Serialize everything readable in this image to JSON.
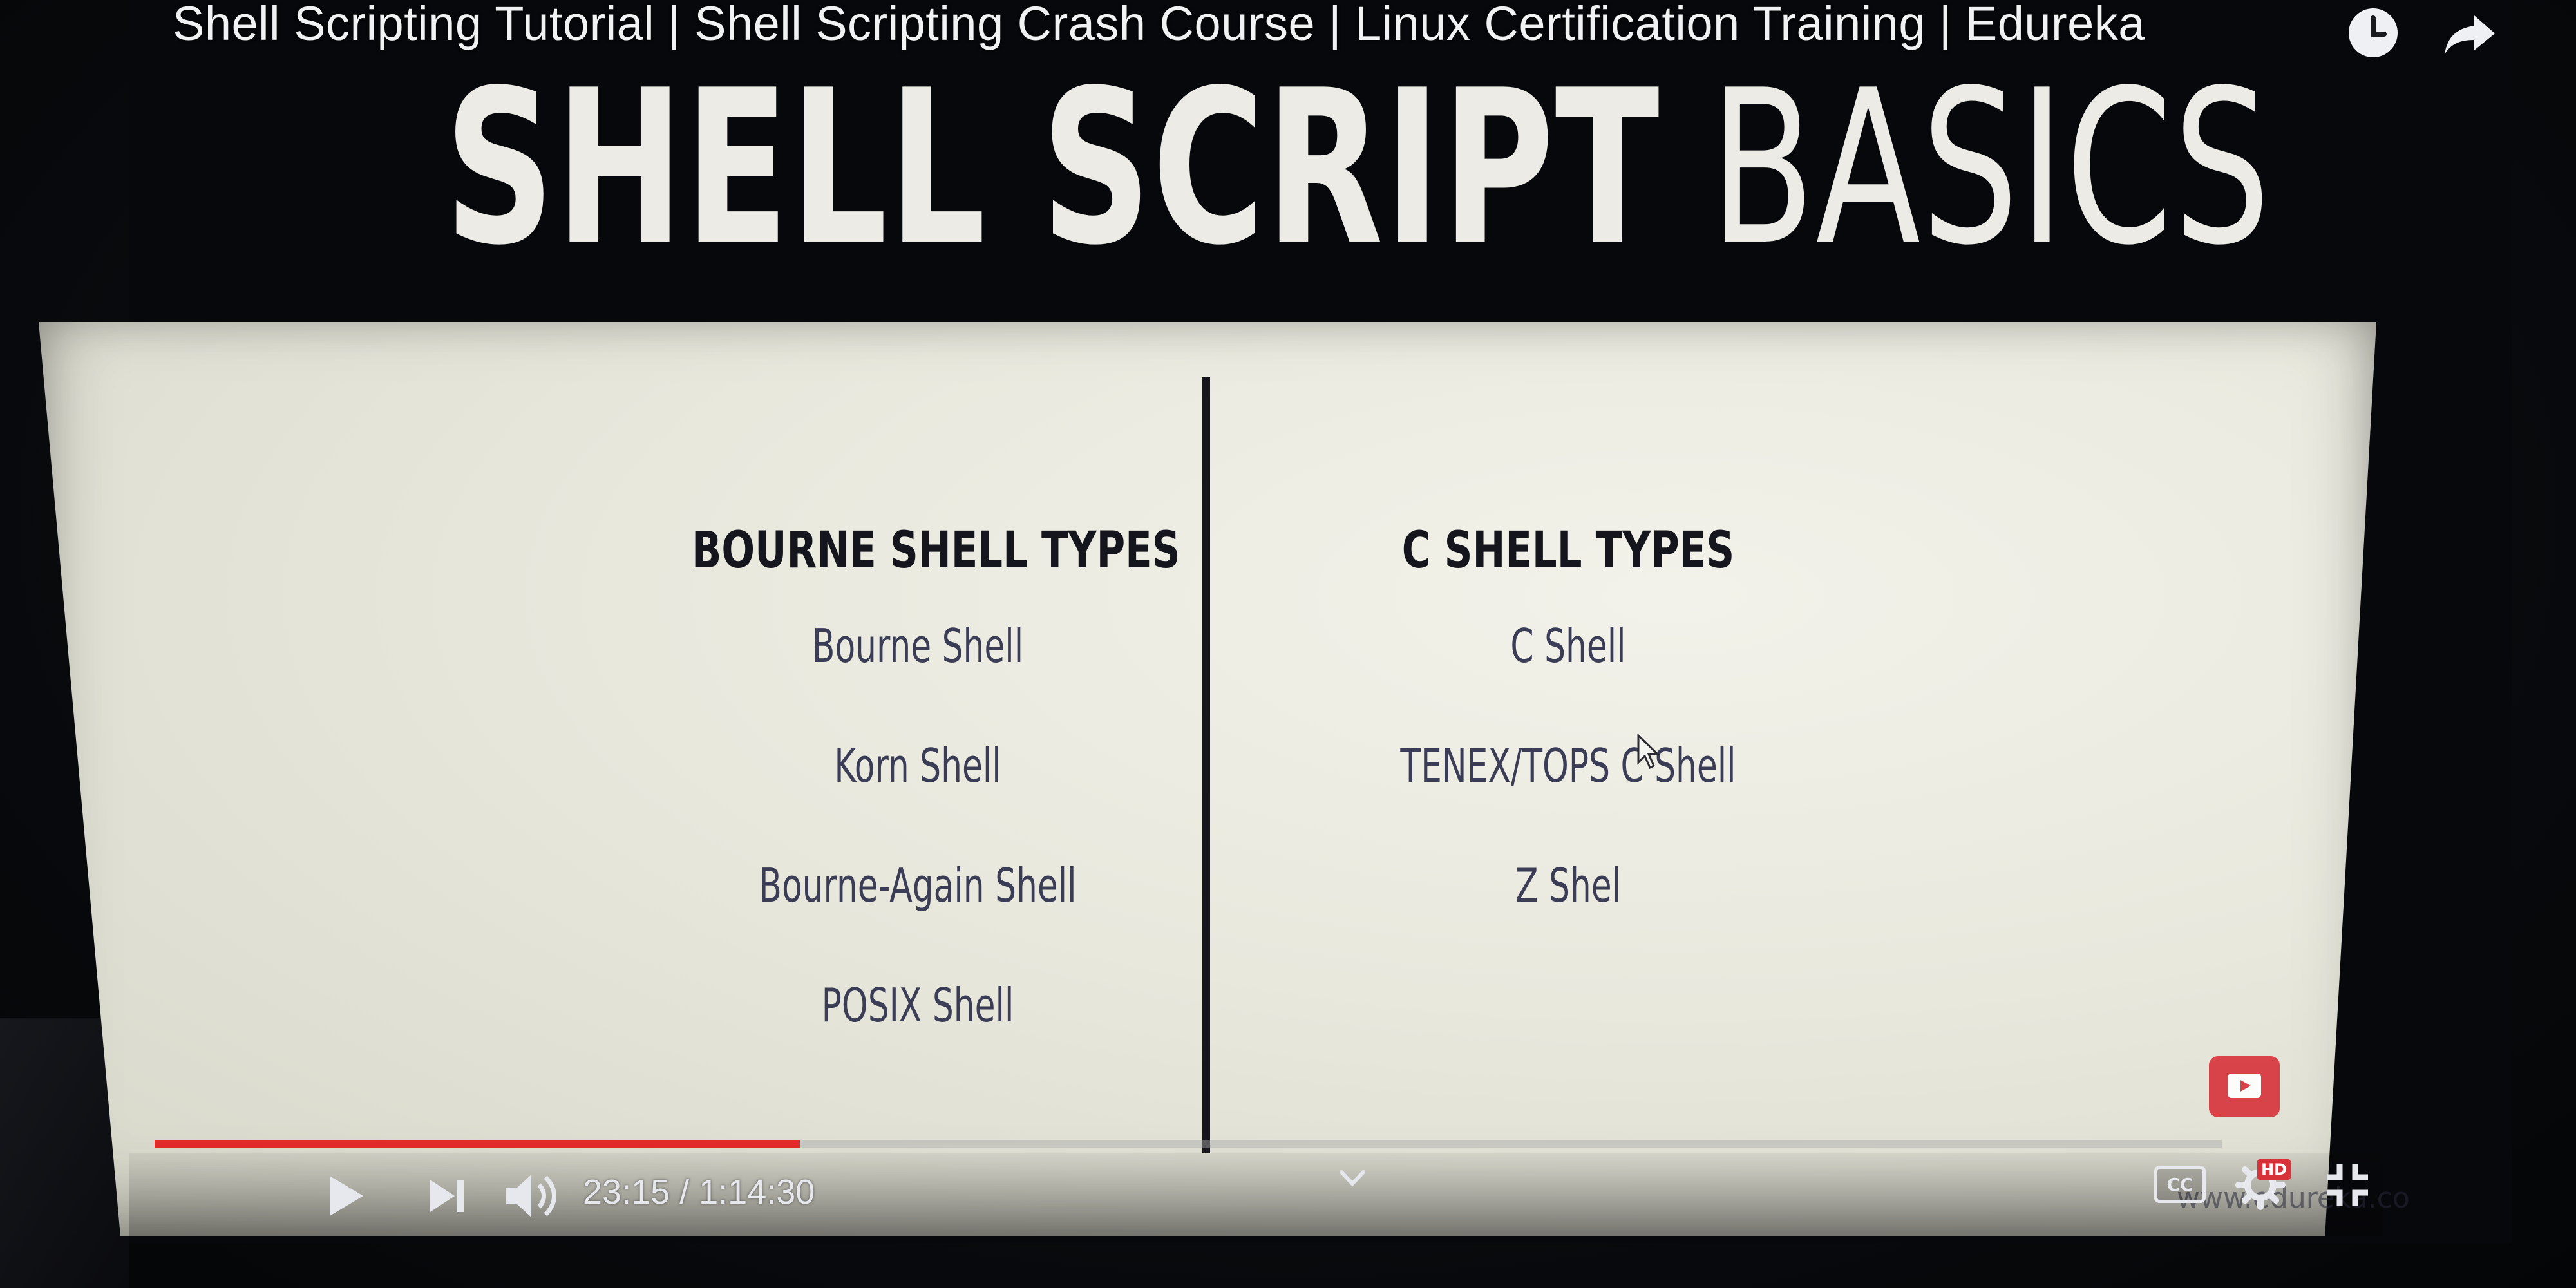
{
  "player": {
    "video_title": "Shell Scripting Tutorial | Shell Scripting Crash Course | Linux Certification Training | Edureka",
    "time_display": "23:15 / 1:14:30",
    "progress_fraction": 0.312,
    "cc_label": "CC",
    "hd_label": "HD",
    "watermark": "www.edureka.co",
    "colors": {
      "progress": "#e22a2a",
      "badge": "#d7313a"
    },
    "icons": {
      "watch_later": "clock-icon",
      "share": "share-arrow-icon",
      "play": "play-icon",
      "next": "skip-next-icon",
      "volume": "volume-icon",
      "chevron": "chevron-down-icon",
      "settings": "gear-icon",
      "fullscreen": "exit-fullscreen-icon",
      "subscribe": "subscribe-logo-icon"
    }
  },
  "slide": {
    "heading_bold": "SHELL SCRIPT",
    "heading_light": "BASICS",
    "left_column": {
      "header": "BOURNE SHELL TYPES",
      "items": [
        "Bourne Shell",
        "Korn Shell",
        "Bourne-Again Shell",
        "POSIX Shell"
      ]
    },
    "right_column": {
      "header": "C SHELL TYPES",
      "items": [
        "C Shell",
        "TENEX/TOPS C Shell",
        "Z Shel"
      ]
    }
  }
}
